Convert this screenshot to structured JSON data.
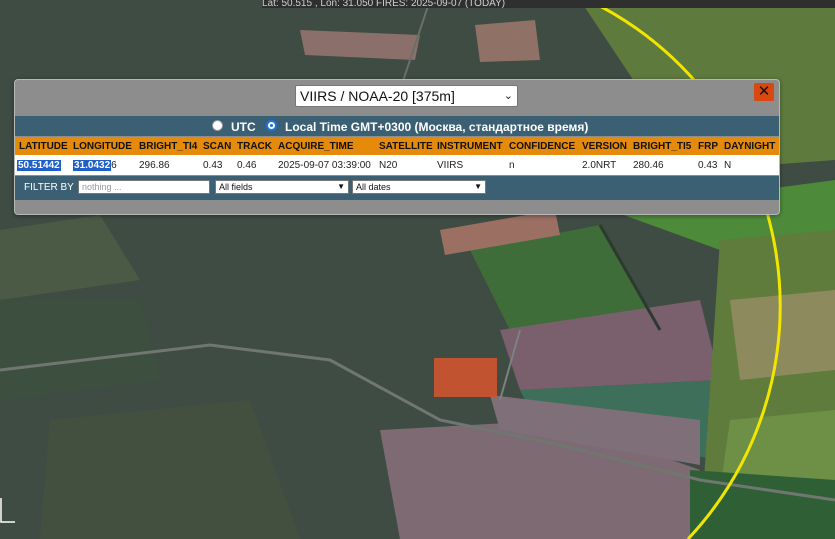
{
  "topbar": {
    "text": "Lat: 50.515 , Lon: 31.050          FIRES: 2025-09-07 (TODAY)"
  },
  "popup": {
    "sensor_selected": "VIIRS / NOAA-20 [375m]",
    "close_glyph": "✕",
    "tz_utc_label": "UTC",
    "tz_local_label": "Local Time GMT+0300 (Москва, стандартное время)",
    "tz_selected": "local",
    "columns": [
      "LATITUDE",
      "LONGITUDE",
      "BRIGHT_TI4",
      "SCAN",
      "TRACK",
      "ACQUIRE_TIME",
      "SATELLITE",
      "INSTRUMENT",
      "CONFIDENCE",
      "VERSION",
      "BRIGHT_TI5",
      "FRP",
      "DAYNIGHT"
    ],
    "row": {
      "lat": "50.51442",
      "lon_highlight": "31.0432",
      "lon_rest": "6",
      "bright_ti4": "296.86",
      "scan": "0.43",
      "track": "0.46",
      "acquire_time": "2025-09-07 03:39:00",
      "satellite": "N20",
      "instrument": "VIIRS",
      "confidence": "n",
      "version": "2.0NRT",
      "bright_ti5": "280.46",
      "frp": "0.43",
      "daynight": "N"
    },
    "filter": {
      "label": "FILTER BY",
      "placeholder": "nothing ...",
      "field_selected": "All fields",
      "date_selected": "All dates"
    }
  },
  "colors": {
    "header_orange": "#e58a0a",
    "bar_blue": "#3b5f73",
    "fire_pixel": "#c9532f",
    "circle_yellow": "#f2e600",
    "highlight": "#1e5fc8"
  }
}
